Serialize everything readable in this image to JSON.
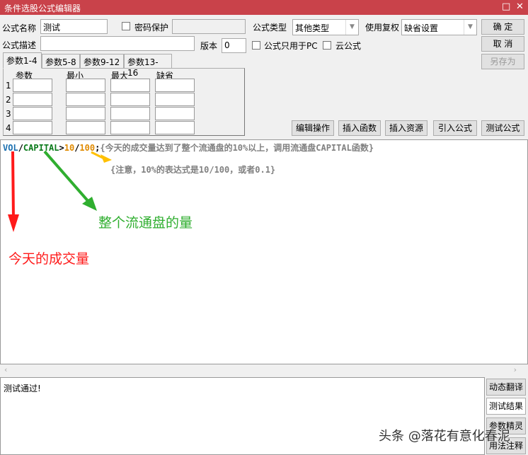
{
  "window": {
    "title": "条件选股公式编辑器",
    "maximize_icon": "□",
    "close_icon": "✕"
  },
  "form": {
    "name_label": "公式名称",
    "name_value": "测试",
    "password_label": "密码保护",
    "type_label": "公式类型",
    "type_value": "其他类型",
    "rights_label": "使用复权",
    "rights_value": "缺省设置",
    "desc_label": "公式描述",
    "desc_value": "",
    "version_label": "版本",
    "version_value": "0",
    "pc_only_label": "公式只用于PC",
    "cloud_label": "云公式"
  },
  "buttons": {
    "ok": "确  定",
    "cancel": "取  消",
    "save_as": "另存为",
    "edit_ops": "编辑操作",
    "insert_func": "插入函数",
    "insert_res": "插入资源",
    "import_formula": "引入公式",
    "test_formula": "测试公式"
  },
  "tabs": [
    "参数1-4",
    "参数5-8",
    "参数9-12",
    "参数13-16"
  ],
  "params": {
    "headers": [
      "参数",
      "最小",
      "最大",
      "缺省"
    ],
    "rows": [
      "1",
      "2",
      "3",
      "4"
    ]
  },
  "code": {
    "line1": [
      {
        "t": "VOL",
        "c": "#1a6fb0"
      },
      {
        "t": "/",
        "c": "#000"
      },
      {
        "t": "CAPITAL",
        "c": "#0a7a1a"
      },
      {
        "t": ">",
        "c": "#000"
      },
      {
        "t": "10",
        "c": "#e08a00"
      },
      {
        "t": "/",
        "c": "#000"
      },
      {
        "t": "100",
        "c": "#e08a00"
      },
      {
        "t": ";",
        "c": "#000"
      },
      {
        "t": "{今天的成交量达到了整个流通盘的10%以上，调用流通盘CAPITAL函数}",
        "c": "#808080"
      }
    ],
    "line2": "{注意，10%的表达式是10/100，或者0.1}"
  },
  "annotations": {
    "green": "整个流通盘的量",
    "red": "今天的成交量",
    "green_color": "#2fae2f",
    "red_color": "#ff1a1a",
    "orange_color": "#ffc000"
  },
  "output": {
    "text": "测试通过!"
  },
  "side_buttons": [
    "动态翻译",
    "测试结果",
    "参数精灵",
    "用法注释"
  ],
  "watermark": "头条 @落花有意化春泥"
}
